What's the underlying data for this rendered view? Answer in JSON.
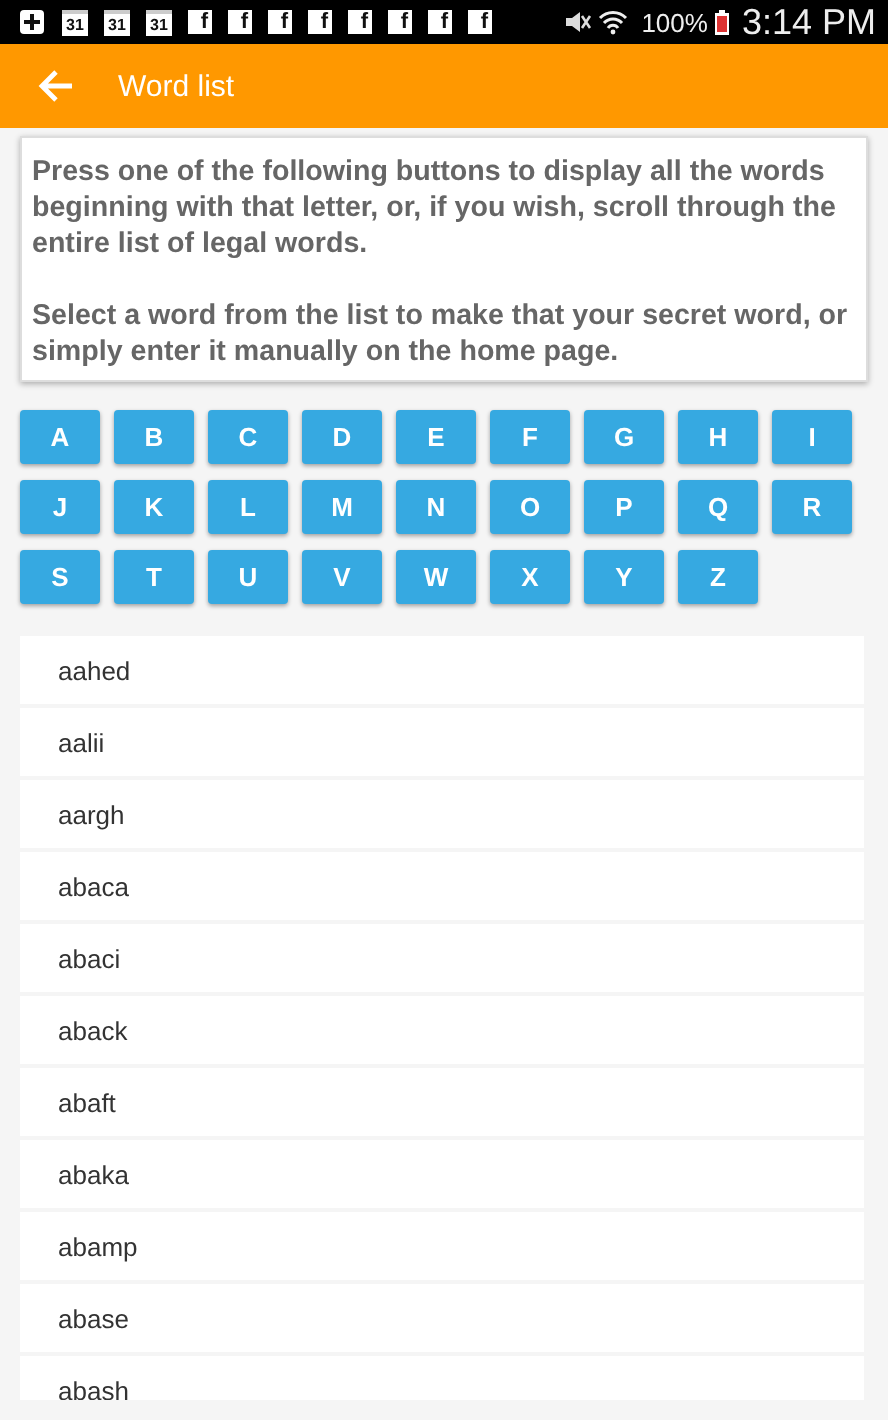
{
  "status_bar": {
    "notifications": [
      {
        "kind": "add"
      },
      {
        "kind": "calendar",
        "text": "31"
      },
      {
        "kind": "calendar",
        "text": "31"
      },
      {
        "kind": "calendar",
        "text": "31"
      },
      {
        "kind": "app",
        "text": "f"
      },
      {
        "kind": "app",
        "text": "f"
      },
      {
        "kind": "app",
        "text": "f"
      },
      {
        "kind": "app",
        "text": "f"
      },
      {
        "kind": "app",
        "text": "f"
      },
      {
        "kind": "app",
        "text": "f"
      },
      {
        "kind": "app",
        "text": "f"
      },
      {
        "kind": "app",
        "text": "f"
      }
    ],
    "battery": "100%",
    "time": "3:14 PM"
  },
  "app_bar": {
    "title": "Word list"
  },
  "instructions": [
    "Press one of the following buttons to display all the words beginning with that letter, or, if you wish, scroll through the entire list of legal words.",
    "Select a word from the list to make that your secret word, or simply enter it manually on the home page."
  ],
  "letters": [
    "A",
    "B",
    "C",
    "D",
    "E",
    "F",
    "G",
    "H",
    "I",
    "J",
    "K",
    "L",
    "M",
    "N",
    "O",
    "P",
    "Q",
    "R",
    "S",
    "T",
    "U",
    "V",
    "W",
    "X",
    "Y",
    "Z"
  ],
  "words": [
    "aahed",
    "aalii",
    "aargh",
    "abaca",
    "abaci",
    "aback",
    "abaft",
    "abaka",
    "abamp",
    "abase",
    "abash"
  ]
}
